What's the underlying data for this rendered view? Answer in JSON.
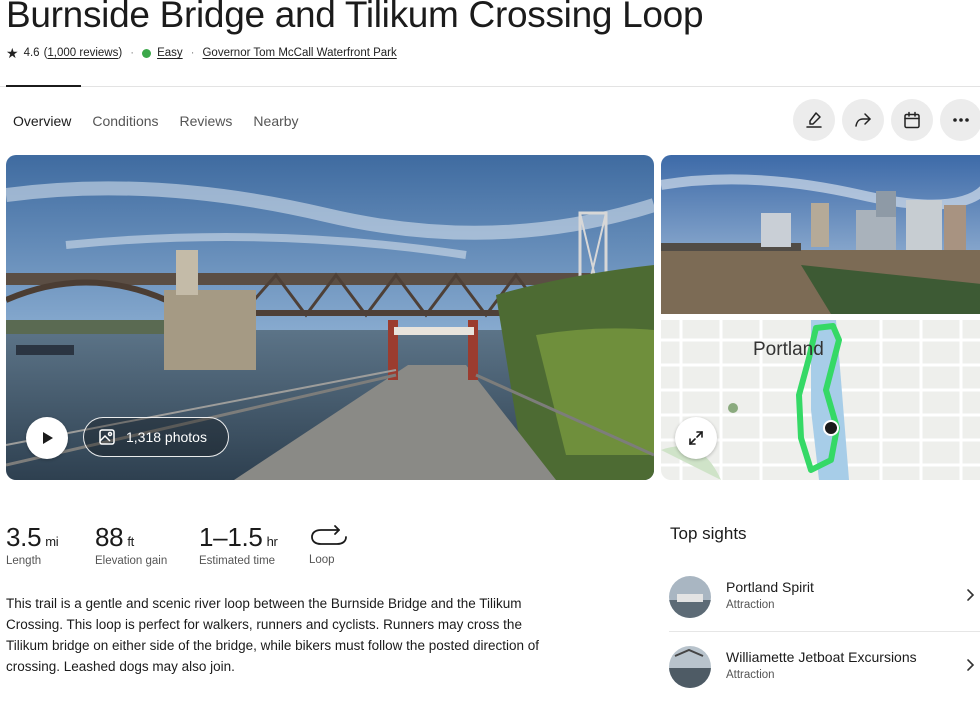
{
  "trail": {
    "title": "Burnside Bridge and Tilikum Crossing Loop",
    "rating": "4.6",
    "reviews_link": "1,000 reviews",
    "difficulty": "Easy",
    "park": "Governor Tom McCall Waterfront Park"
  },
  "tabs": [
    "Overview",
    "Conditions",
    "Reviews",
    "Nearby"
  ],
  "actions": {
    "icons": [
      "signature-icon",
      "share-icon",
      "calendar-icon",
      "more-icon"
    ]
  },
  "gallery": {
    "photos_label": "1,318 photos"
  },
  "map": {
    "city_label": "Portland"
  },
  "stats": [
    {
      "value": "3.5",
      "unit": "mi",
      "label": "Length"
    },
    {
      "value": "88",
      "unit": "ft",
      "label": "Elevation gain"
    },
    {
      "value": "1–1.5",
      "unit": "hr",
      "label": "Estimated time"
    },
    {
      "value": "",
      "unit": "",
      "label": "Loop"
    }
  ],
  "description": "This trail is a gentle and scenic river loop between the Burnside Bridge and the Tilikum Crossing. This loop is perfect for walkers, runners and cyclists. Runners may cross the Tilikum bridge on either side of the bridge, while bikers must follow the posted direction of crossing. Leashed dogs may also join.",
  "top_sights": {
    "title": "Top sights",
    "items": [
      {
        "name": "Portland Spirit",
        "type": "Attraction"
      },
      {
        "name": "Williamette Jetboat Excursions",
        "type": "Attraction"
      }
    ]
  },
  "colors": {
    "easy": "#3ca84a",
    "route": "#3de06a",
    "text": "#1b1b1b"
  }
}
